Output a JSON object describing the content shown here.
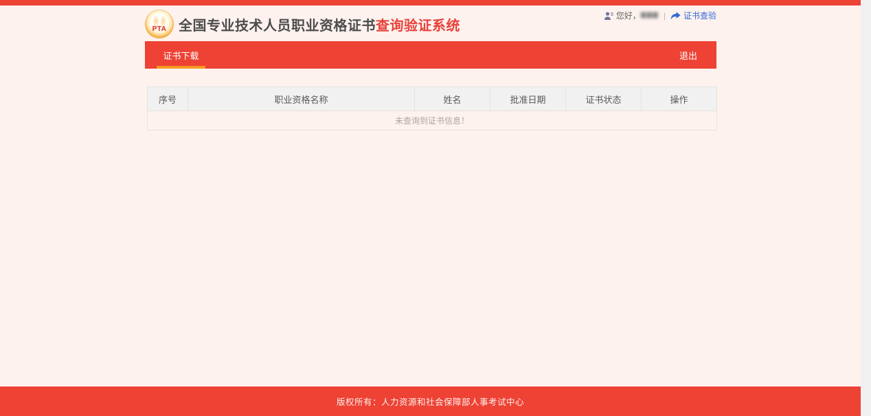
{
  "colors": {
    "bar_red": "#ed4234",
    "title_accent_red": "#e8413a",
    "underline_orange": "#f59a23",
    "link_blue": "#3668d4",
    "page_bg": "#fdf2ee",
    "header_row_bg": "#f1f1f1"
  },
  "header": {
    "logo_text": "PTA",
    "title_main": "全国专业技术人员职业资格证书",
    "title_accent": "查询验证系统",
    "greeting": "您好，",
    "user_name_masked": "▆▆▆",
    "separator": "|",
    "verify_link_label": "证书查验"
  },
  "nav": {
    "tabs": [
      {
        "label": "证书下载",
        "active": true
      }
    ],
    "logout_label": "退出"
  },
  "table": {
    "headers": [
      "序号",
      "职业资格名称",
      "姓名",
      "批准日期",
      "证书状态",
      "操作"
    ],
    "rows": [],
    "empty_message": "未查询到证书信息！"
  },
  "footer": {
    "copyright": "版权所有：人力资源和社会保障部人事考试中心"
  }
}
